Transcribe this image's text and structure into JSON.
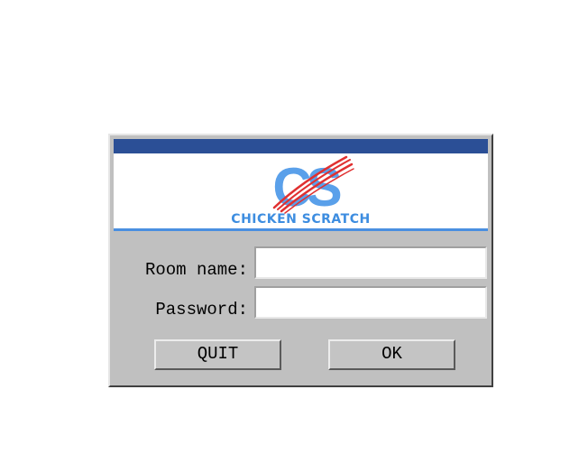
{
  "logo": {
    "monogram": "CS",
    "name": "CHICKEN SCRATCH"
  },
  "form": {
    "room_label": "Room name:",
    "room_value": "",
    "password_label": "Password:",
    "password_value": ""
  },
  "buttons": {
    "quit_label": "QUIT",
    "ok_label": "OK"
  },
  "colors": {
    "titlebar": "#2b4f96",
    "logo_blue": "#4a8fe0",
    "scratch_red": "#e03030",
    "dialog_bg": "#c0c0c0"
  }
}
